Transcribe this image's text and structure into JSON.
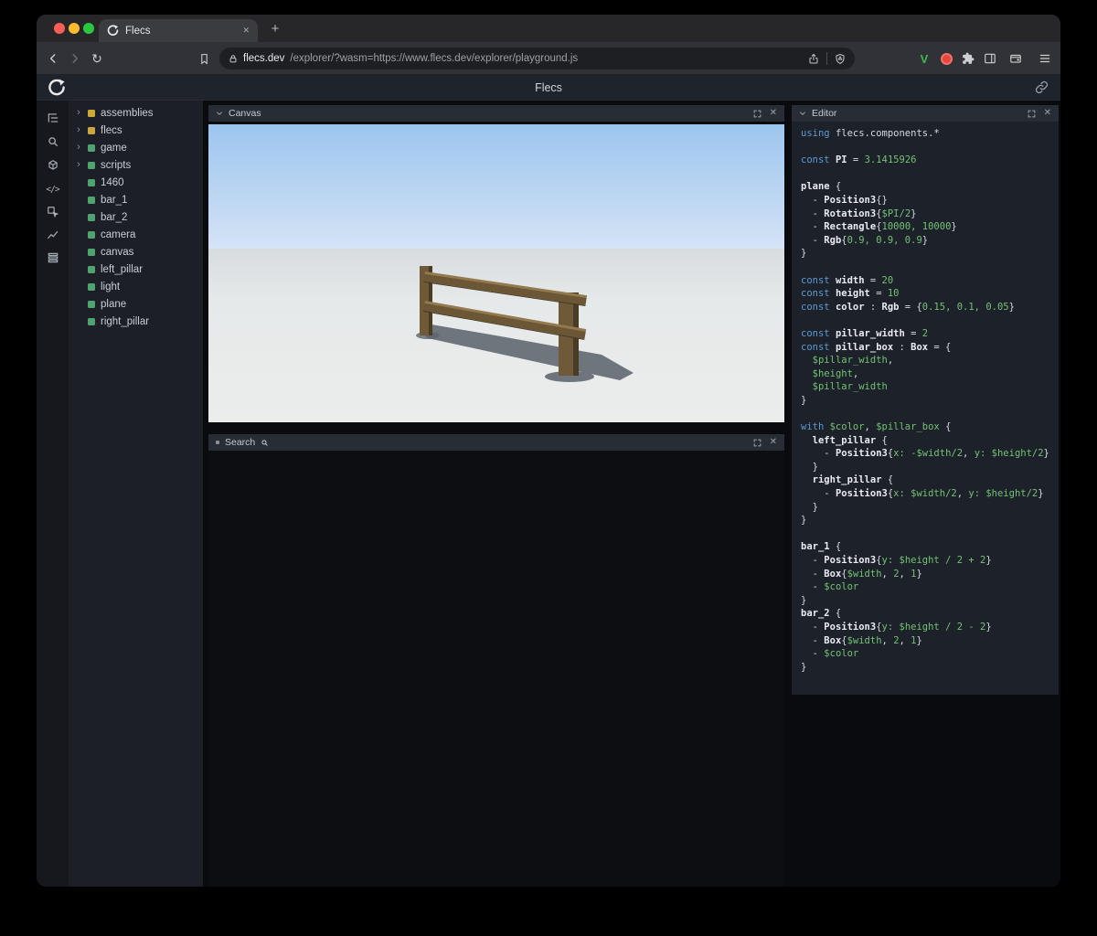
{
  "window": {
    "traffic_lights": [
      "#ff5f57",
      "#febc2e",
      "#28c840"
    ]
  },
  "browser": {
    "tab_title": "Flecs",
    "url_host": "flecs.dev",
    "url_rest": "/explorer/?wasm=https://www.flecs.dev/explorer/playground.js",
    "v_badge": "V"
  },
  "icons": {
    "close_glyph": "✕",
    "new_tab_glyph": "+",
    "reload_glyph": "↻",
    "expand_arrow_glyph": "›",
    "code_glyph": "</>"
  },
  "page": {
    "title": "Flecs"
  },
  "panels": {
    "canvas": {
      "title": "Canvas"
    },
    "search": {
      "title": "Search"
    },
    "editor": {
      "title": "Editor"
    }
  },
  "tree": {
    "items": [
      {
        "label": "assemblies",
        "color": "#c9a83c",
        "expandable": true
      },
      {
        "label": "flecs",
        "color": "#c9a83c",
        "expandable": true
      },
      {
        "label": "game",
        "color": "#4fa36e",
        "expandable": true
      },
      {
        "label": "scripts",
        "color": "#4fa36e",
        "expandable": true
      },
      {
        "label": "1460",
        "color": "#4fa36e",
        "expandable": false
      },
      {
        "label": "bar_1",
        "color": "#4fa36e",
        "expandable": false
      },
      {
        "label": "bar_2",
        "color": "#4fa36e",
        "expandable": false
      },
      {
        "label": "camera",
        "color": "#4fa36e",
        "expandable": false
      },
      {
        "label": "canvas",
        "color": "#4fa36e",
        "expandable": false
      },
      {
        "label": "left_pillar",
        "color": "#4fa36e",
        "expandable": false
      },
      {
        "label": "light",
        "color": "#4fa36e",
        "expandable": false
      },
      {
        "label": "plane",
        "color": "#4fa36e",
        "expandable": false
      },
      {
        "label": "right_pillar",
        "color": "#4fa36e",
        "expandable": false
      }
    ]
  },
  "editor": {
    "lines": [
      [
        [
          "k",
          "using "
        ],
        [
          "t",
          "flecs.components.*"
        ]
      ],
      [],
      [
        [
          "k",
          "const "
        ],
        [
          "c",
          "PI"
        ],
        [
          "t",
          " = "
        ],
        [
          "v",
          "3.1415926"
        ]
      ],
      [],
      [
        [
          "c",
          "plane"
        ],
        [
          "t",
          " {"
        ]
      ],
      [
        [
          "t",
          "  - "
        ],
        [
          "c",
          "Position3"
        ],
        [
          "t",
          "{}"
        ]
      ],
      [
        [
          "t",
          "  - "
        ],
        [
          "c",
          "Rotation3"
        ],
        [
          "t",
          "{"
        ],
        [
          "v",
          "$PI/2"
        ],
        [
          "t",
          "}"
        ]
      ],
      [
        [
          "t",
          "  - "
        ],
        [
          "c",
          "Rectangle"
        ],
        [
          "t",
          "{"
        ],
        [
          "v",
          "10000, 10000"
        ],
        [
          "t",
          "}"
        ]
      ],
      [
        [
          "t",
          "  - "
        ],
        [
          "c",
          "Rgb"
        ],
        [
          "t",
          "{"
        ],
        [
          "v",
          "0.9, 0.9, 0.9"
        ],
        [
          "t",
          "}"
        ]
      ],
      [
        [
          "t",
          "}"
        ]
      ],
      [],
      [
        [
          "k",
          "const "
        ],
        [
          "c",
          "width"
        ],
        [
          "t",
          " = "
        ],
        [
          "v",
          "20"
        ]
      ],
      [
        [
          "k",
          "const "
        ],
        [
          "c",
          "height"
        ],
        [
          "t",
          " = "
        ],
        [
          "v",
          "10"
        ]
      ],
      [
        [
          "k",
          "const "
        ],
        [
          "c",
          "color"
        ],
        [
          "t",
          " : "
        ],
        [
          "c",
          "Rgb"
        ],
        [
          "t",
          " = {"
        ],
        [
          "v",
          "0.15, 0.1, 0.05"
        ],
        [
          "t",
          "}"
        ]
      ],
      [],
      [
        [
          "k",
          "const "
        ],
        [
          "c",
          "pillar_width"
        ],
        [
          "t",
          " = "
        ],
        [
          "v",
          "2"
        ]
      ],
      [
        [
          "k",
          "const "
        ],
        [
          "c",
          "pillar_box"
        ],
        [
          "t",
          " : "
        ],
        [
          "c",
          "Box"
        ],
        [
          "t",
          " = {"
        ]
      ],
      [
        [
          "t",
          "  "
        ],
        [
          "v",
          "$pillar_width"
        ],
        [
          "t",
          ","
        ]
      ],
      [
        [
          "t",
          "  "
        ],
        [
          "v",
          "$height"
        ],
        [
          "t",
          ","
        ]
      ],
      [
        [
          "t",
          "  "
        ],
        [
          "v",
          "$pillar_width"
        ]
      ],
      [
        [
          "t",
          "}"
        ]
      ],
      [],
      [
        [
          "k",
          "with "
        ],
        [
          "v",
          "$color"
        ],
        [
          "t",
          ", "
        ],
        [
          "v",
          "$pillar_box"
        ],
        [
          "t",
          " {"
        ]
      ],
      [
        [
          "t",
          "  "
        ],
        [
          "c",
          "left_pillar"
        ],
        [
          "t",
          " {"
        ]
      ],
      [
        [
          "t",
          "    - "
        ],
        [
          "c",
          "Position3"
        ],
        [
          "t",
          "{"
        ],
        [
          "v",
          "x: -$width/2"
        ],
        [
          "t",
          ", "
        ],
        [
          "v",
          "y: $height/2"
        ],
        [
          "t",
          "}"
        ]
      ],
      [
        [
          "t",
          "  }"
        ]
      ],
      [
        [
          "t",
          "  "
        ],
        [
          "c",
          "right_pillar"
        ],
        [
          "t",
          " {"
        ]
      ],
      [
        [
          "t",
          "    - "
        ],
        [
          "c",
          "Position3"
        ],
        [
          "t",
          "{"
        ],
        [
          "v",
          "x: $width/2"
        ],
        [
          "t",
          ", "
        ],
        [
          "v",
          "y: $height/2"
        ],
        [
          "t",
          "}"
        ]
      ],
      [
        [
          "t",
          "  }"
        ]
      ],
      [
        [
          "t",
          "}"
        ]
      ],
      [],
      [
        [
          "c",
          "bar_1"
        ],
        [
          "t",
          " {"
        ]
      ],
      [
        [
          "t",
          "  - "
        ],
        [
          "c",
          "Position3"
        ],
        [
          "t",
          "{"
        ],
        [
          "v",
          "y: $height / 2 + 2"
        ],
        [
          "t",
          "}"
        ]
      ],
      [
        [
          "t",
          "  - "
        ],
        [
          "c",
          "Box"
        ],
        [
          "t",
          "{"
        ],
        [
          "v",
          "$width"
        ],
        [
          "t",
          ", "
        ],
        [
          "v",
          "2"
        ],
        [
          "t",
          ", "
        ],
        [
          "v",
          "1"
        ],
        [
          "t",
          "}"
        ]
      ],
      [
        [
          "t",
          "  - "
        ],
        [
          "v",
          "$color"
        ]
      ],
      [
        [
          "t",
          "}"
        ]
      ],
      [
        [
          "c",
          "bar_2"
        ],
        [
          "t",
          " {"
        ]
      ],
      [
        [
          "t",
          "  - "
        ],
        [
          "c",
          "Position3"
        ],
        [
          "t",
          "{"
        ],
        [
          "v",
          "y: $height / 2 - 2"
        ],
        [
          "t",
          "}"
        ]
      ],
      [
        [
          "t",
          "  - "
        ],
        [
          "c",
          "Box"
        ],
        [
          "t",
          "{"
        ],
        [
          "v",
          "$width"
        ],
        [
          "t",
          ", "
        ],
        [
          "v",
          "2"
        ],
        [
          "t",
          ", "
        ],
        [
          "v",
          "1"
        ],
        [
          "t",
          "}"
        ]
      ],
      [
        [
          "t",
          "  - "
        ],
        [
          "v",
          "$color"
        ]
      ],
      [
        [
          "t",
          "}"
        ]
      ]
    ]
  },
  "colors": {
    "keyword": "#5d9ad2",
    "value": "#74c274",
    "plain": "#d7dae0",
    "identifier": "#e9ecf1",
    "entity_green": "#4fa36e",
    "module_yellow": "#c9a83c"
  }
}
